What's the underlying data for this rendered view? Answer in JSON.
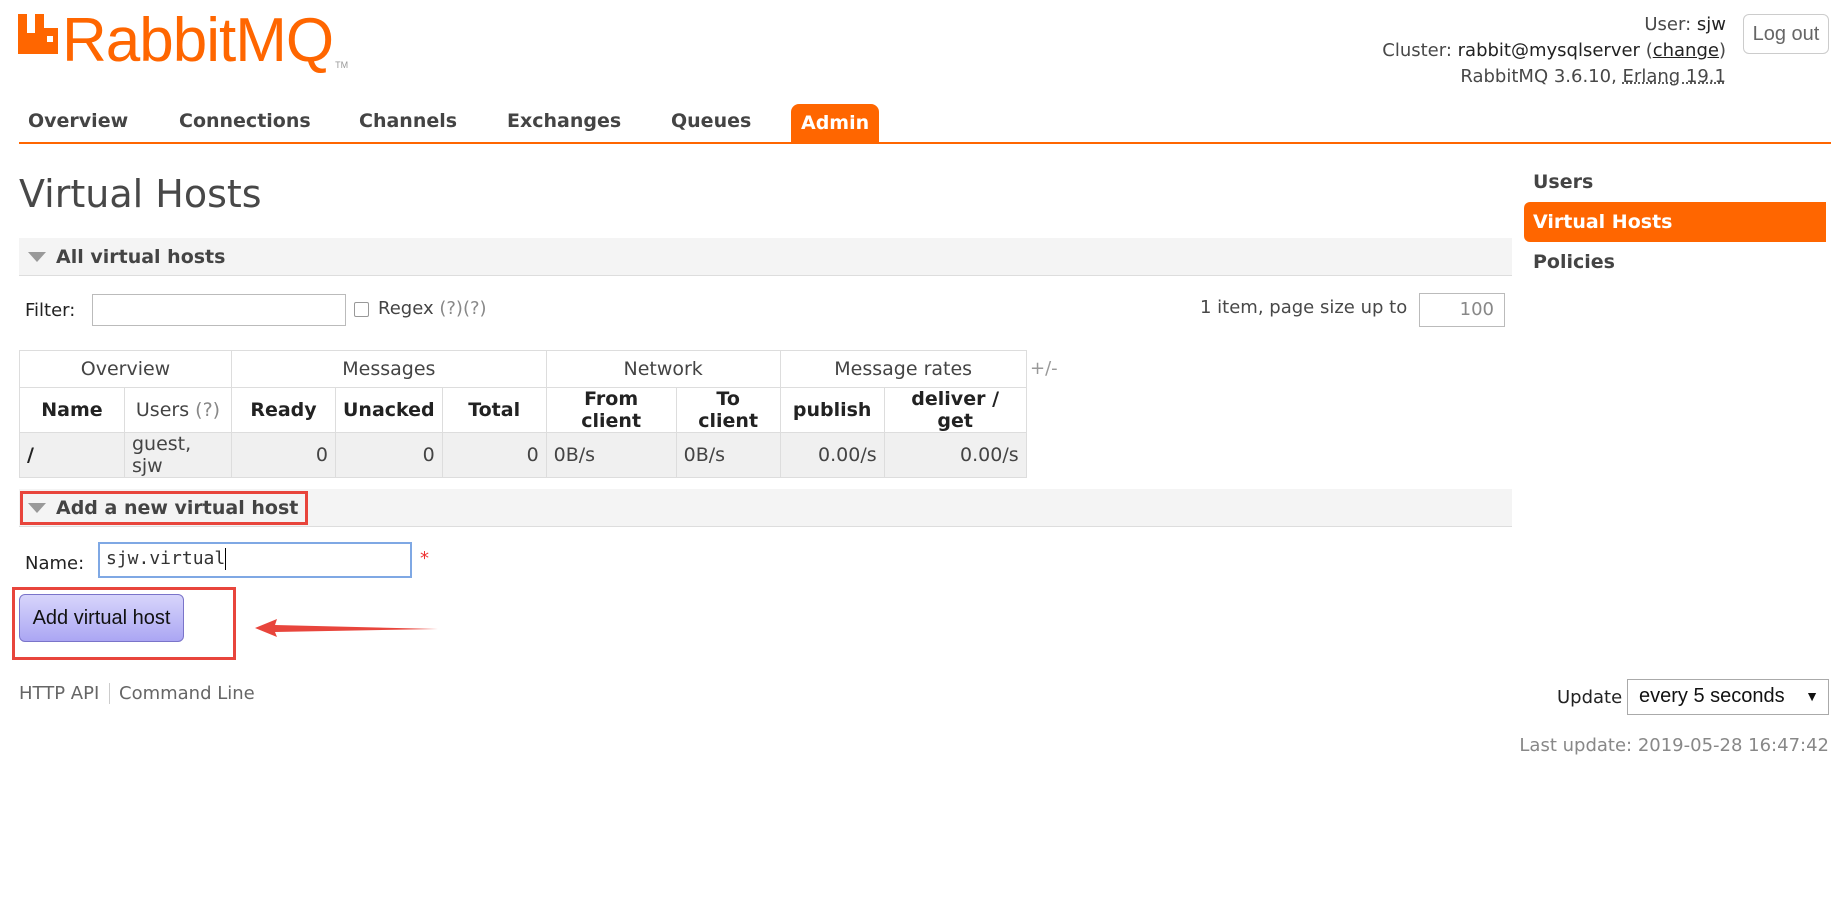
{
  "app": {
    "brand": "RabbitMQ",
    "tm": "TM",
    "accent": "#ff6600"
  },
  "header": {
    "user_label": "User:",
    "user": "sjw",
    "cluster_label": "Cluster:",
    "cluster": "rabbit@mysqlserver",
    "change_open": "(",
    "change": "change",
    "change_close": ")",
    "version": "RabbitMQ 3.6.10,",
    "erlang": "Erlang 19.1",
    "logout": "Log out"
  },
  "nav": {
    "tabs": [
      "Overview",
      "Connections",
      "Channels",
      "Exchanges",
      "Queues",
      "Admin"
    ],
    "active": "Admin"
  },
  "page": {
    "title": "Virtual Hosts"
  },
  "sidebar": {
    "items": [
      "Users",
      "Virtual Hosts",
      "Policies"
    ],
    "active": "Virtual Hosts"
  },
  "all_vhosts": {
    "heading": "All virtual hosts",
    "filter_label": "Filter:",
    "filter_value": "",
    "regex_label": "Regex",
    "regex_help": "(?)(?)",
    "regex_checked": false,
    "page_info": "1 item, page size up to",
    "page_size": "100",
    "group_headers": [
      "Overview",
      "Messages",
      "Network",
      "Message rates"
    ],
    "columns": [
      "Name",
      "Users",
      "Ready",
      "Unacked",
      "Total",
      "From client",
      "To client",
      "publish",
      "deliver / get"
    ],
    "users_help": "(?)",
    "rows": [
      {
        "name": "/",
        "users": "guest, sjw",
        "ready": "0",
        "unacked": "0",
        "total": "0",
        "from_client": "0B/s",
        "to_client": "0B/s",
        "publish": "0.00/s",
        "deliver_get": "0.00/s"
      }
    ],
    "plus_minus": "+/-"
  },
  "add_vhost": {
    "heading": "Add a new virtual host",
    "name_label": "Name:",
    "name_value": "sjw.virtual",
    "required_mark": "*",
    "button": "Add virtual host",
    "annotation_color": "#e8453c"
  },
  "footer": {
    "http_api": "HTTP API",
    "command_line": "Command Line",
    "update_label": "Update",
    "update_value": "every 5 seconds",
    "update_caret": "▼",
    "last_update": "Last update: 2019-05-28 16:47:42"
  }
}
